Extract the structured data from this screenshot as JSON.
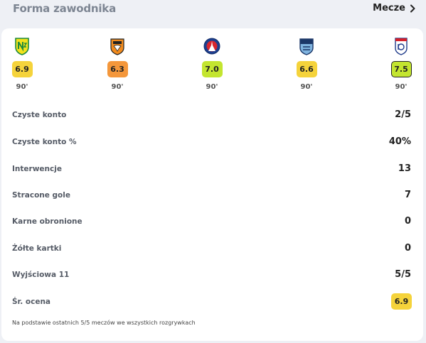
{
  "header": {
    "title": "Forma zawodnika",
    "link_label": "Mecze"
  },
  "matches": [
    {
      "team_icon": "nantes-crest-icon",
      "rating": "6.9",
      "rating_color": "#f5d33b",
      "minutes": "90'",
      "outlined": false
    },
    {
      "team_icon": "lorient-crest-icon",
      "rating": "6.3",
      "rating_color": "#f4973b",
      "minutes": "90'",
      "outlined": false
    },
    {
      "team_icon": "psg-crest-icon",
      "rating": "7.0",
      "rating_color": "#c3e52f",
      "minutes": "90'",
      "outlined": false
    },
    {
      "team_icon": "le-havre-crest-icon",
      "rating": "6.6",
      "rating_color": "#f5d33b",
      "minutes": "90'",
      "outlined": false
    },
    {
      "team_icon": "lyon-crest-icon",
      "rating": "7.5",
      "rating_color": "#c3e52f",
      "minutes": "90'",
      "outlined": true
    }
  ],
  "stats": [
    {
      "label": "Czyste konto",
      "value": "2/5"
    },
    {
      "label": "Czyste konto %",
      "value": "40%"
    },
    {
      "label": "Interwencje",
      "value": "13"
    },
    {
      "label": "Stracone gole",
      "value": "7"
    },
    {
      "label": "Karne obronione",
      "value": "0"
    },
    {
      "label": "Żółte kartki",
      "value": "0"
    },
    {
      "label": "Wyjściowa 11",
      "value": "5/5"
    },
    {
      "label": "Śr. ocena",
      "value": "6.9",
      "badge_color": "#f5d33b"
    }
  ],
  "footnote": "Na podstawie ostatnich 5/5 meczów we wszystkich rozgrywkach"
}
